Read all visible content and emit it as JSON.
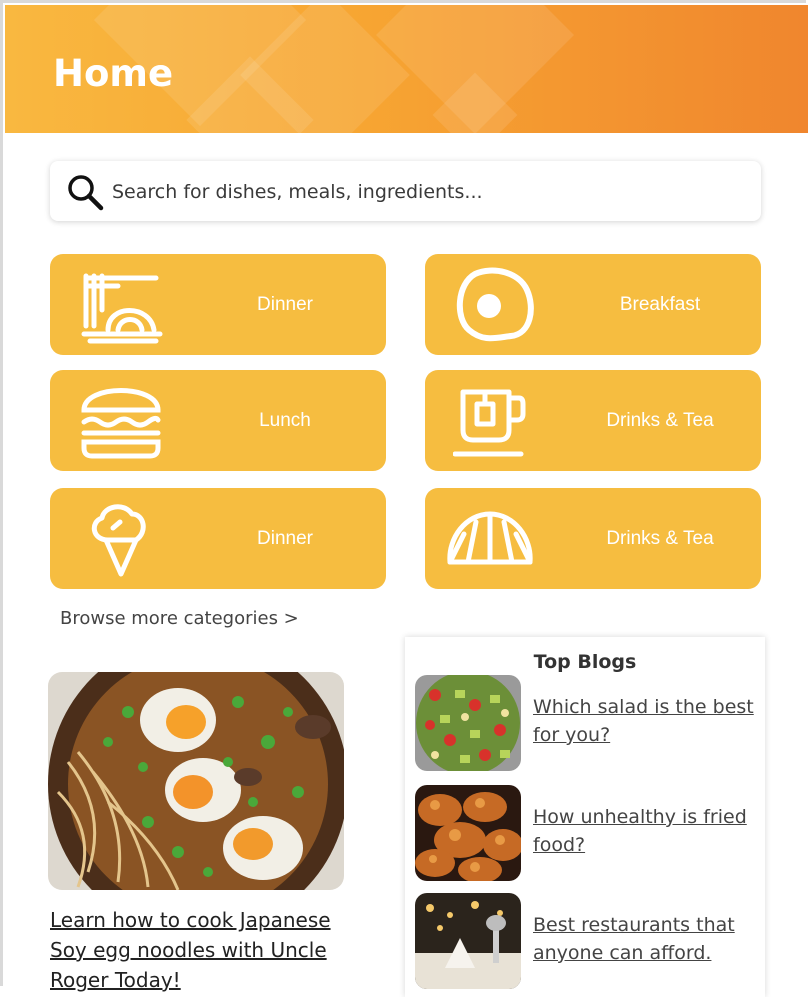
{
  "header": {
    "title": "Home"
  },
  "search": {
    "placeholder": "Search for dishes, meals, ingredients..."
  },
  "categories": [
    {
      "label": "Dinner",
      "icon": "noodles-icon"
    },
    {
      "label": "Breakfast",
      "icon": "fried-egg-icon"
    },
    {
      "label": "Lunch",
      "icon": "burger-icon"
    },
    {
      "label": "Drinks & Tea",
      "icon": "tea-cup-icon"
    },
    {
      "label": "Dinner",
      "icon": "ice-cream-icon"
    },
    {
      "label": "Drinks & Tea",
      "icon": "croissant-icon"
    }
  ],
  "browse_more": "Browse more categories >",
  "feature": {
    "title": "Learn how to cook Japanese Soy egg noodles with Uncle Roger Today!",
    "image": "noodle-bowl-photo"
  },
  "blogs": {
    "title": "Top Blogs",
    "items": [
      {
        "title": "Which salad is the best for you?",
        "image": "salad-photo"
      },
      {
        "title": "How unhealthy is fried food?",
        "image": "fried-chicken-photo"
      },
      {
        "title": "Best restaurants that anyone can afford.",
        "image": "restaurant-photo"
      }
    ]
  },
  "colors": {
    "header_start": "#f9b840",
    "header_end": "#f0862e",
    "category_bg": "#f6bd40"
  }
}
